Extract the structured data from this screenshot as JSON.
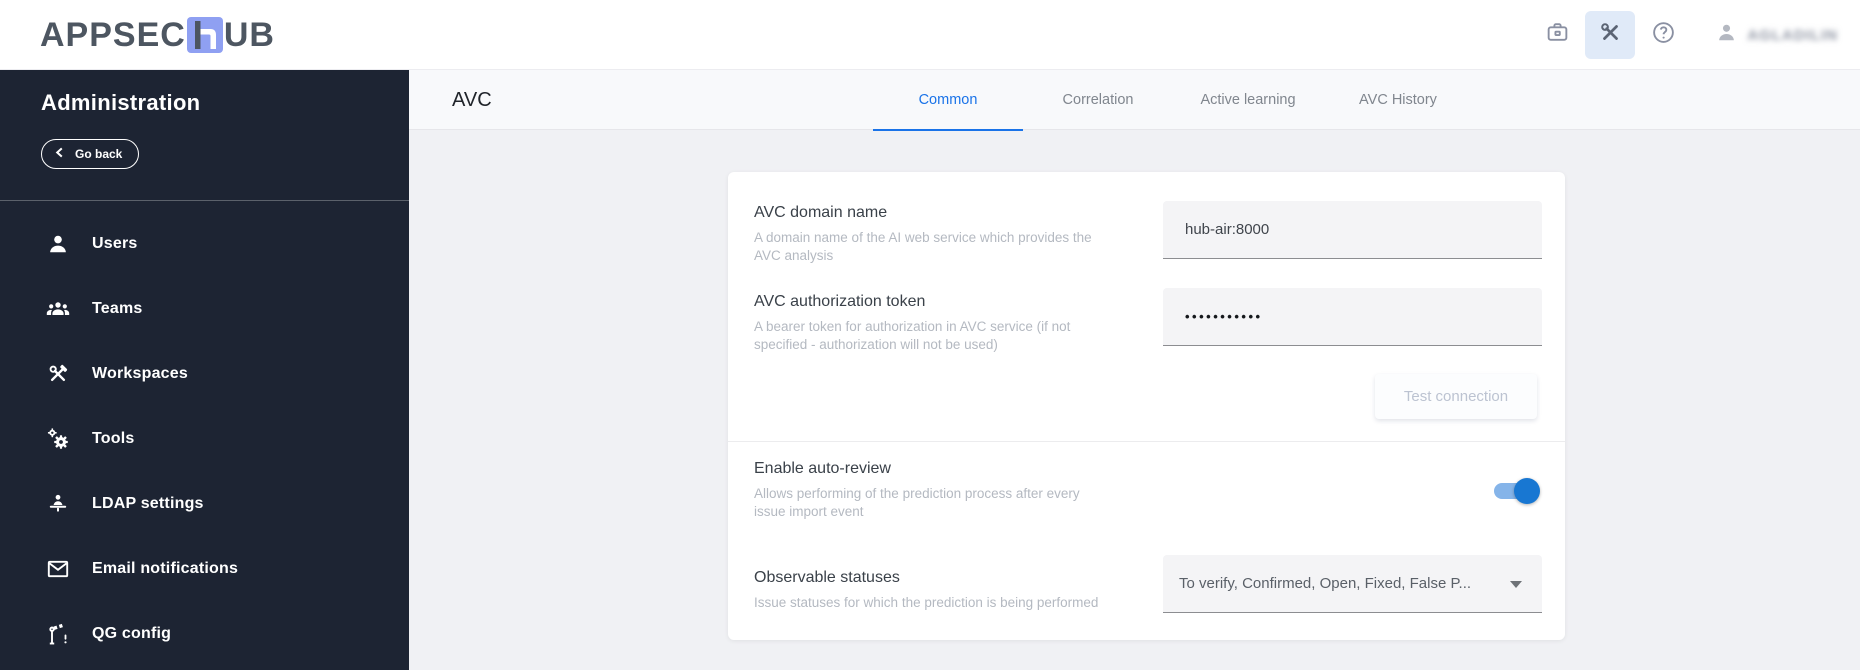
{
  "header": {
    "logo": {
      "prefix": "APPSEC",
      "h_letter": "h",
      "suffix": "UB"
    },
    "username": "AGLADILIN",
    "colors": {
      "logo_square": "#8fa0f2",
      "tools_button_bg": "#e0eaf8"
    }
  },
  "sidebar": {
    "title": "Administration",
    "back_label": "Go back",
    "items": [
      {
        "label": "Users",
        "icon": "user-icon"
      },
      {
        "label": "Teams",
        "icon": "teams-icon"
      },
      {
        "label": "Workspaces",
        "icon": "hammer-wrench-icon"
      },
      {
        "label": "Tools",
        "icon": "gears-icon"
      },
      {
        "label": "LDAP settings",
        "icon": "ldap-person-icon"
      },
      {
        "label": "Email notifications",
        "icon": "envelope-icon"
      },
      {
        "label": "QG config",
        "icon": "barrier-icon"
      }
    ],
    "bg_color": "#1d2433"
  },
  "page": {
    "title": "AVC",
    "tabs": [
      {
        "label": "Common",
        "active": true
      },
      {
        "label": "Correlation",
        "active": false
      },
      {
        "label": "Active learning",
        "active": false
      },
      {
        "label": "AVC History",
        "active": false
      }
    ],
    "accent_color": "#1a73e8"
  },
  "form": {
    "domain": {
      "label": "AVC domain name",
      "description": "A domain name of the AI web service which provides the AVC analysis",
      "value": "hub-air:8000"
    },
    "token": {
      "label": "AVC authorization token",
      "description": "A bearer token for authorization in AVC service (if not specified - authorization will not be used)",
      "value_masked": "•••••••••••"
    },
    "test_button_label": "Test connection",
    "auto_review": {
      "label": "Enable auto-review",
      "description": "Allows performing of the prediction process after every issue import event",
      "enabled": true,
      "toggle_on_color": "#1877d2"
    },
    "observable": {
      "label": "Observable statuses",
      "description": "Issue statuses for which the prediction is being performed",
      "value": "To verify, Confirmed, Open, Fixed, False P..."
    }
  }
}
